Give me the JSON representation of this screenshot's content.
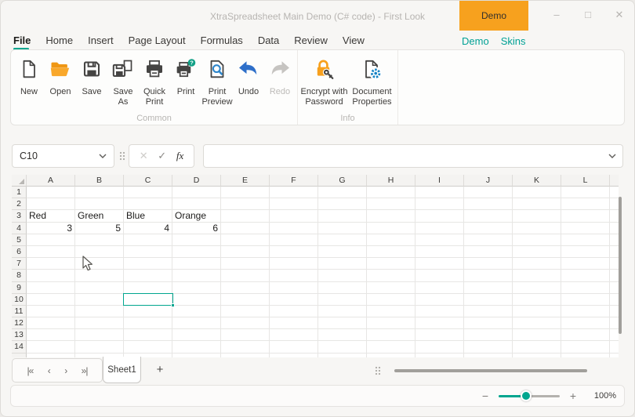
{
  "colors": {
    "accent_teal": "#00a68f",
    "brand_orange": "#f7a11e",
    "undo_blue": "#2e6fc9",
    "preview_blue": "#2e86cb",
    "gear_blue": "#1482c4",
    "badge_green": "#12a086",
    "disabled_gray": "#bdbbb8"
  },
  "window": {
    "title": "XtraSpreadsheet Main Demo (C# code) - First Look",
    "demo_button_label": "Demo",
    "minimize_glyph": "–",
    "maximize_glyph": "□",
    "close_glyph": "✕"
  },
  "ribbon": {
    "tabs": [
      {
        "label": "File",
        "active": true
      },
      {
        "label": "Home",
        "active": false
      },
      {
        "label": "Insert",
        "active": false
      },
      {
        "label": "Page Layout",
        "active": false
      },
      {
        "label": "Formulas",
        "active": false
      },
      {
        "label": "Data",
        "active": false
      },
      {
        "label": "Review",
        "active": false
      },
      {
        "label": "View",
        "active": false
      }
    ],
    "links": [
      {
        "label": "Demo"
      },
      {
        "label": "Skins"
      }
    ],
    "groups": [
      {
        "label": "Common",
        "buttons": [
          {
            "label": "New",
            "icon": "new-document-icon",
            "enabled": true
          },
          {
            "label": "Open",
            "icon": "open-folder-icon",
            "enabled": true
          },
          {
            "label": "Save",
            "icon": "save-icon",
            "enabled": true
          },
          {
            "label": "Save As",
            "icon": "save-as-icon",
            "enabled": true
          },
          {
            "label": "Quick Print",
            "icon": "quick-print-icon",
            "enabled": true
          },
          {
            "label": "Print",
            "icon": "print-help-icon",
            "enabled": true
          },
          {
            "label": "Print Preview",
            "icon": "print-preview-icon",
            "enabled": true
          },
          {
            "label": "Undo",
            "icon": "undo-icon",
            "enabled": true
          },
          {
            "label": "Redo",
            "icon": "redo-icon",
            "enabled": false
          }
        ]
      },
      {
        "label": "Info",
        "buttons": [
          {
            "label": "Encrypt with Password",
            "icon": "encrypt-password-icon",
            "enabled": true
          },
          {
            "label": "Document Properties",
            "icon": "document-properties-icon",
            "enabled": true
          }
        ]
      }
    ]
  },
  "formula_bar": {
    "cell_reference": "C10",
    "cancel_glyph": "✕",
    "confirm_glyph": "✓",
    "function_label": "fx",
    "formula_value": ""
  },
  "grid": {
    "columns": [
      "A",
      "B",
      "C",
      "D",
      "E",
      "F",
      "G",
      "H",
      "I",
      "J",
      "K",
      "L"
    ],
    "row_count": 14,
    "cells": {
      "A3": "Red",
      "B3": "Green",
      "C3": "Blue",
      "D3": "Orange",
      "A4": 3,
      "B4": 5,
      "C4": 4,
      "D4": 6
    },
    "selected_cell": "C10"
  },
  "sheet_bar": {
    "nav": [
      {
        "name": "first",
        "glyph": "|«"
      },
      {
        "name": "previous",
        "glyph": "‹"
      },
      {
        "name": "next",
        "glyph": "›"
      },
      {
        "name": "last",
        "glyph": "»|"
      }
    ],
    "tabs": [
      {
        "label": "Sheet1",
        "active": true
      }
    ],
    "add_label": "+"
  },
  "status_bar": {
    "zoom_out_label": "−",
    "zoom_in_label": "+",
    "zoom_level": "100%"
  }
}
